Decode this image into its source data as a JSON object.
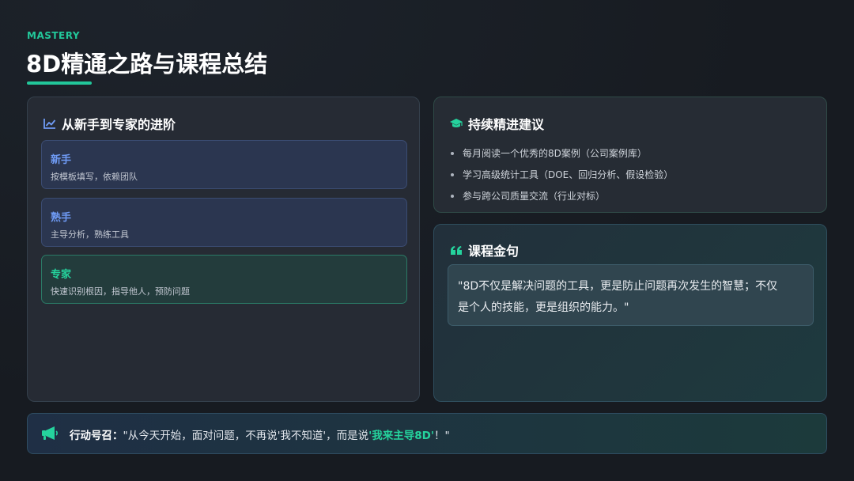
{
  "header": {
    "eyebrow": "MASTERY",
    "title": "8D精通之路与课程总结",
    "accent_color": "#22c79a"
  },
  "progression": {
    "heading": "从新手到专家的进阶",
    "icon": "chart-line-icon",
    "stages": [
      {
        "title": "新手",
        "desc": "按模板填写，依赖团队"
      },
      {
        "title": "熟手",
        "desc": "主导分析，熟练工具"
      },
      {
        "title": "专家",
        "desc": "快速识别根因，指导他人，预防问题"
      }
    ]
  },
  "tips": {
    "heading": "持续精进建议",
    "icon": "graduation-cap-icon",
    "items": [
      "每月阅读一个优秀的8D案例（公司案例库）",
      "学习高级统计工具（DOE、回归分析、假设检验）",
      "参与跨公司质量交流（行业对标）"
    ]
  },
  "quote": {
    "heading": "课程金句",
    "icon": "quote-icon",
    "line1": "\"8D不仅是解决问题的工具，更是防止问题再次发生的智慧；不仅",
    "line2": "是个人的技能，更是组织的能力。\""
  },
  "cta": {
    "icon": "megaphone-icon",
    "label": "行动号召：",
    "text_before": "\"从今天开始，面对问题，不再说'我不知道'，而是说",
    "highlight": "'我来主导8D'",
    "text_after": "！\""
  }
}
